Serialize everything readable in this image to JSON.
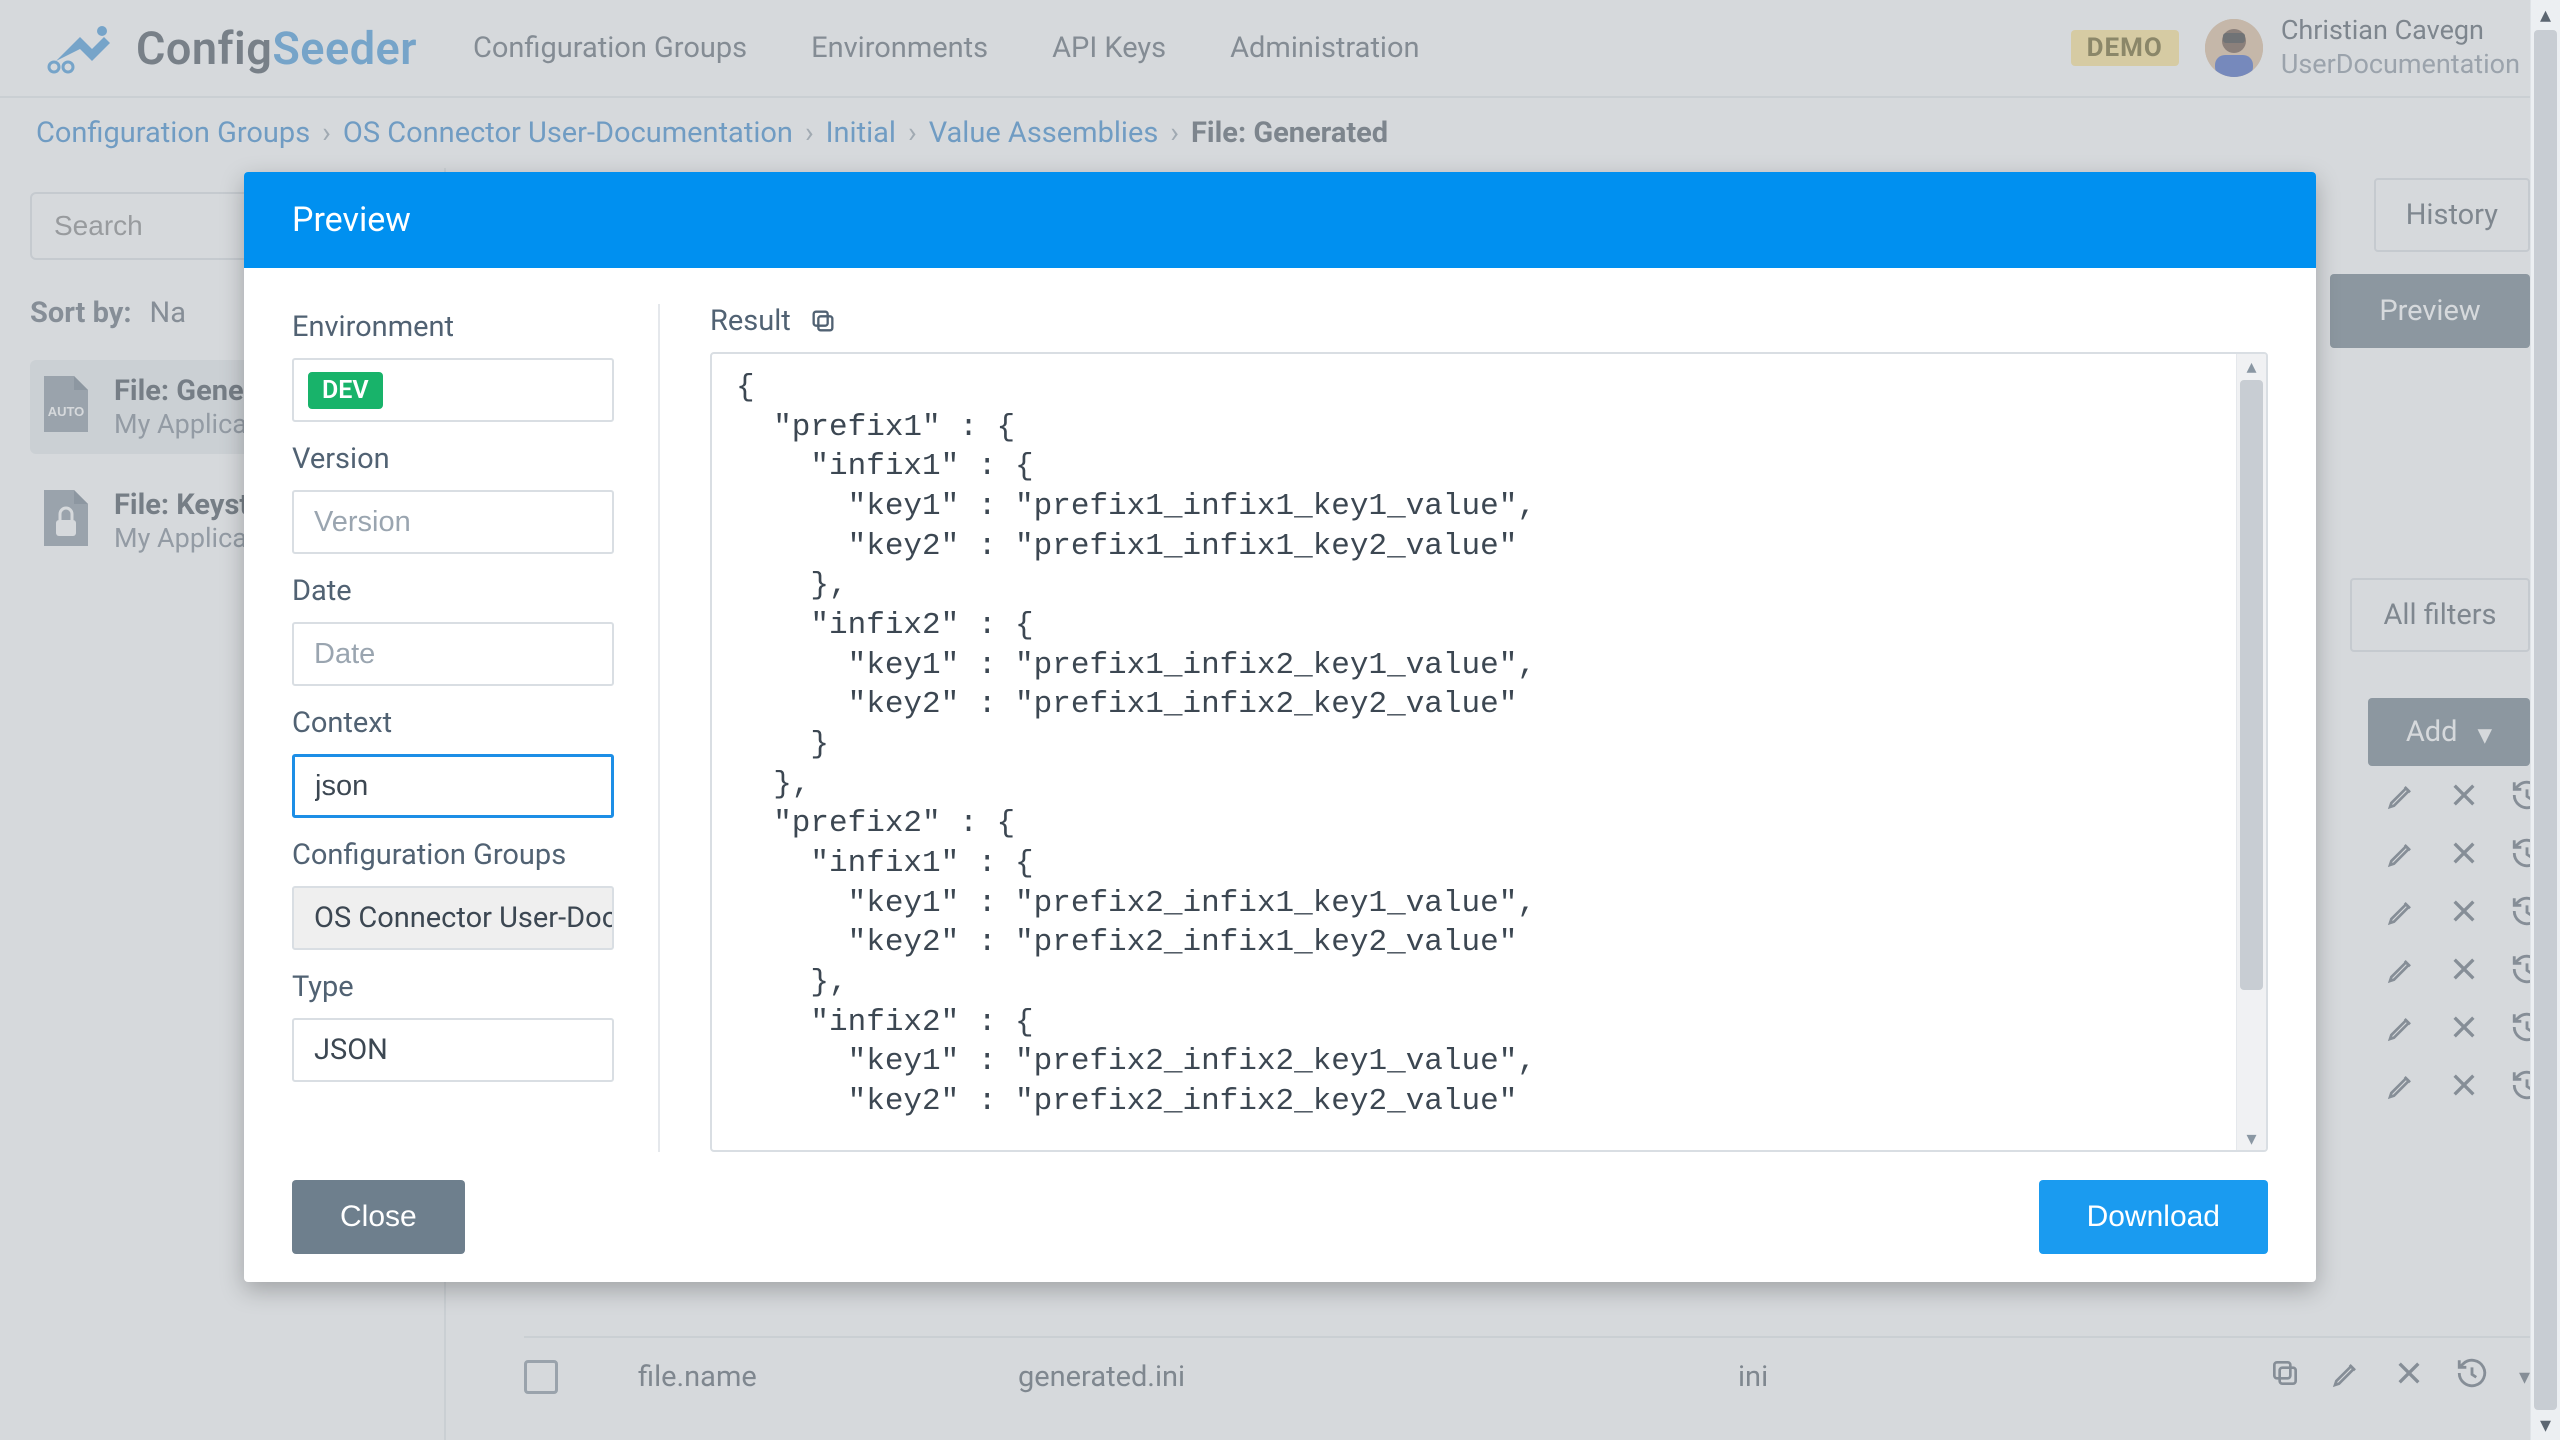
{
  "brand": {
    "part1": "Config",
    "part2": "Seeder"
  },
  "nav": {
    "items": [
      "Configuration Groups",
      "Environments",
      "API Keys",
      "Administration"
    ]
  },
  "demo_badge": "DEMO",
  "user": {
    "name": "Christian Cavegn",
    "role": "UserDocumentation"
  },
  "breadcrumb": {
    "items": [
      "Configuration Groups",
      "OS Connector User-Documentation",
      "Initial",
      "Value Assemblies"
    ],
    "current": "File: Generated"
  },
  "sidebar": {
    "search_placeholder": "Search",
    "sort_label": "Sort by:",
    "sort_value": "Na",
    "items": [
      {
        "title": "File: Genera",
        "subtitle": "My Applica",
        "badge": "AUTO",
        "active": true
      },
      {
        "title": "File: Keysto",
        "subtitle": "My Applica",
        "badge": "TLS",
        "active": false
      }
    ]
  },
  "right": {
    "tab": "History",
    "preview_btn": "Preview",
    "all_filters": "All filters",
    "add": "Add",
    "bottom_row": {
      "key": "file.name",
      "value": "generated.ini",
      "ctx": "ini"
    }
  },
  "modal": {
    "title": "Preview",
    "form": {
      "environment_label": "Environment",
      "environment_value": "DEV",
      "version_label": "Version",
      "version_placeholder": "Version",
      "date_label": "Date",
      "date_placeholder": "Date",
      "context_label": "Context",
      "context_value": "json",
      "cg_label": "Configuration Groups",
      "cg_value": "OS Connector User-Docum",
      "type_label": "Type",
      "type_value": "JSON"
    },
    "result_label": "Result",
    "result_text": "{\n  \"prefix1\" : {\n    \"infix1\" : {\n      \"key1\" : \"prefix1_infix1_key1_value\",\n      \"key2\" : \"prefix1_infix1_key2_value\"\n    },\n    \"infix2\" : {\n      \"key1\" : \"prefix1_infix2_key1_value\",\n      \"key2\" : \"prefix1_infix2_key2_value\"\n    }\n  },\n  \"prefix2\" : {\n    \"infix1\" : {\n      \"key1\" : \"prefix2_infix1_key1_value\",\n      \"key2\" : \"prefix2_infix1_key2_value\"\n    },\n    \"infix2\" : {\n      \"key1\" : \"prefix2_infix2_key1_value\",\n      \"key2\" : \"prefix2_infix2_key2_value\"",
    "close": "Close",
    "download": "Download"
  },
  "colors": {
    "accent": "#0090f0",
    "env_dev": "#18b36a"
  }
}
